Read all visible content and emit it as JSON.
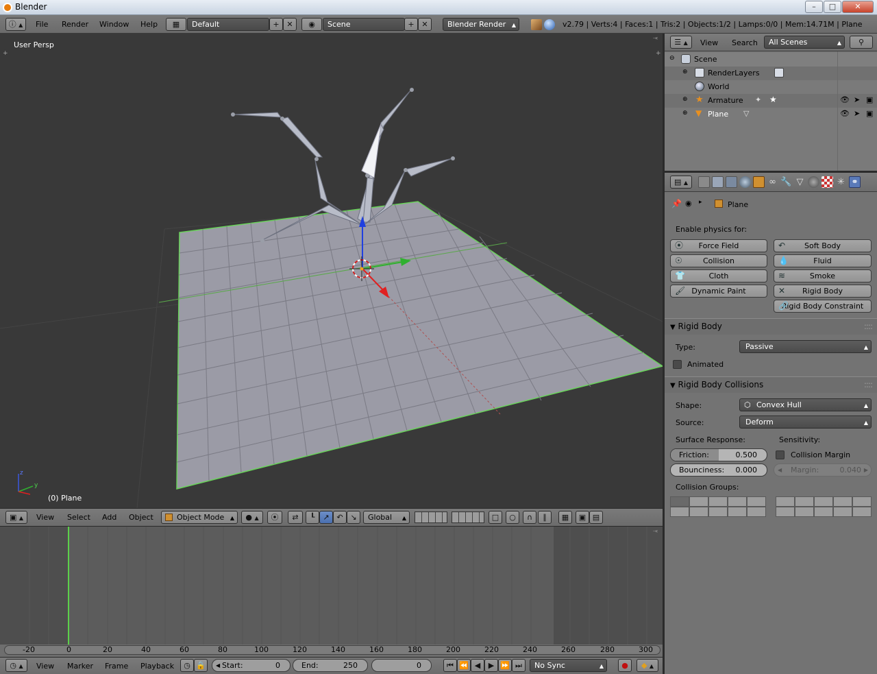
{
  "window": {
    "title": "Blender"
  },
  "info_header": {
    "menus": [
      "File",
      "Render",
      "Window",
      "Help"
    ],
    "screen_layout": "Default",
    "scene": "Scene",
    "render_engine": "Blender Render",
    "stats": "v2.79 | Verts:4 | Faces:1 | Tris:2 | Objects:1/2 | Lamps:0/0 | Mem:14.71M | Plane"
  },
  "viewport": {
    "view_label": "User Persp",
    "object_label": "(0) Plane"
  },
  "viewport_header": {
    "menus": [
      "View",
      "Select",
      "Add",
      "Object"
    ],
    "mode": "Object Mode",
    "orientation": "Global"
  },
  "timeline": {
    "ticks": [
      "-20",
      "0",
      "20",
      "40",
      "60",
      "80",
      "100",
      "120",
      "140",
      "160",
      "180",
      "200",
      "220",
      "240",
      "260",
      "280",
      "300"
    ],
    "menus": [
      "View",
      "Marker",
      "Frame",
      "Playback"
    ],
    "start_label": "Start:",
    "start_value": "0",
    "end_label": "End:",
    "end_value": "250",
    "current_frame": "0",
    "sync": "No Sync"
  },
  "outliner": {
    "menus": [
      "View",
      "Search"
    ],
    "display_mode": "All Scenes",
    "items": [
      {
        "label": "Scene"
      },
      {
        "label": "RenderLayers"
      },
      {
        "label": "World"
      },
      {
        "label": "Armature"
      },
      {
        "label": "Plane"
      }
    ]
  },
  "properties": {
    "context_object": "Plane",
    "enable_physics_label": "Enable physics for:",
    "physics_buttons": [
      "Force Field",
      "Soft Body",
      "Collision",
      "Fluid",
      "Cloth",
      "Smoke",
      "Dynamic Paint",
      "Rigid Body",
      "Rigid Body Constraint"
    ],
    "rigid_body": {
      "title": "Rigid Body",
      "type_label": "Type:",
      "type_value": "Passive",
      "animated_label": "Animated"
    },
    "collisions": {
      "title": "Rigid Body Collisions",
      "shape_label": "Shape:",
      "shape_value": "Convex Hull",
      "source_label": "Source:",
      "source_value": "Deform",
      "surface_response_label": "Surface Response:",
      "sensitivity_label": "Sensitivity:",
      "friction_label": "Friction:",
      "friction_value": "0.500",
      "bounciness_label": "Bounciness:",
      "bounciness_value": "0.000",
      "collision_margin_label": "Collision Margin",
      "margin_label": "Margin:",
      "margin_value": "0.040",
      "collision_groups_label": "Collision Groups:"
    }
  }
}
